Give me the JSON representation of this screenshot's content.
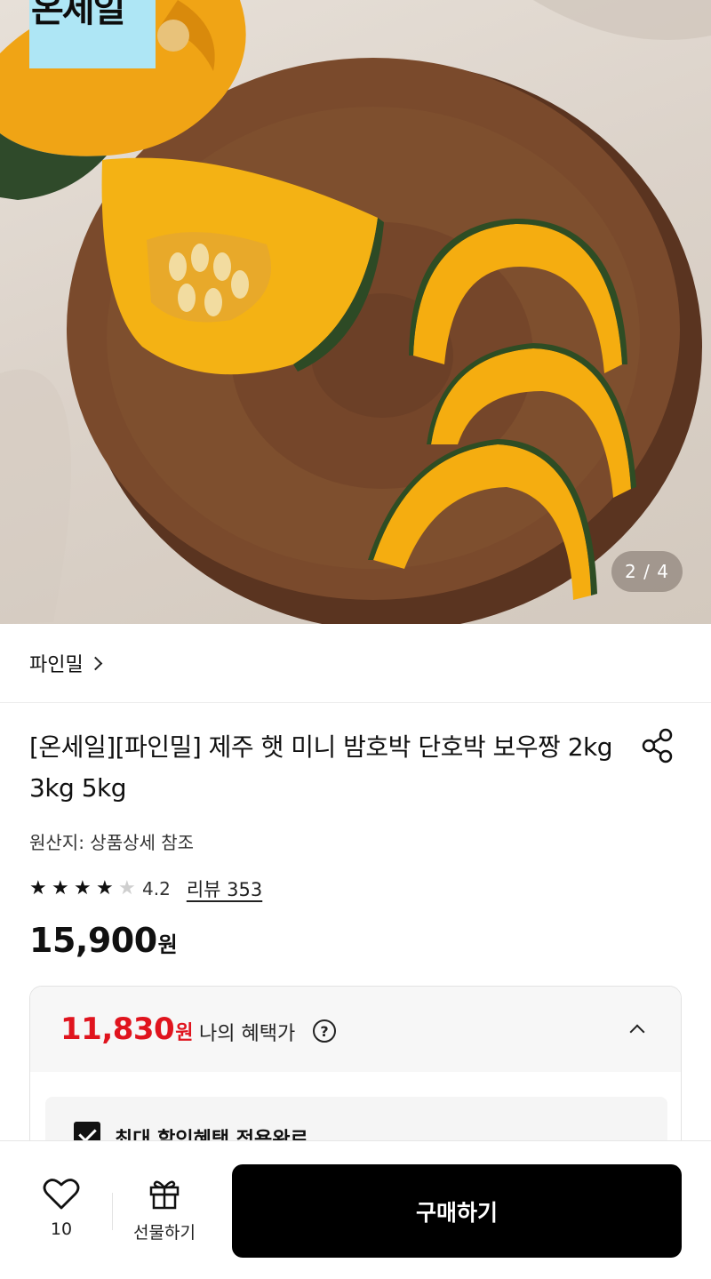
{
  "hero": {
    "promo_badge": "온세일",
    "image_counter": "2 / 4",
    "image_subject": "pumpkin-slices-on-wooden-board"
  },
  "seller": {
    "name": "파인밀"
  },
  "product": {
    "title": "[온세일][파인밀] 제주 햇 미니 밤호박 단호박 보우짱 2kg 3kg 5kg",
    "origin": "원산지: 상품상세 참조",
    "rating": 4.2,
    "rating_text": "4.2",
    "review_link": "리뷰 353",
    "price": "15,900",
    "price_unit": "원"
  },
  "benefit": {
    "price": "11,830",
    "price_unit": "원",
    "label": "나의 혜택가",
    "help_icon": "question-circle-icon",
    "collapse_icon": "chevron-up-icon",
    "max_discount_label": "최대 할인혜택 적용완료",
    "max_discount_checked": true
  },
  "bottom_bar": {
    "like_icon": "heart-icon",
    "like_count": "10",
    "gift_icon": "gift-icon",
    "gift_label": "선물하기",
    "buy_label": "구매하기"
  },
  "colors": {
    "accent_red": "#e0141e",
    "buy_button": "#000000",
    "promo_badge": "#aee6f5"
  }
}
